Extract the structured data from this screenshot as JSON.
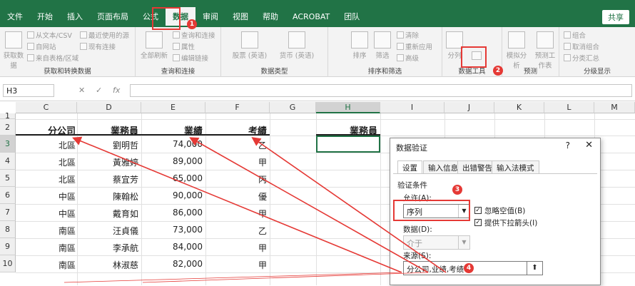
{
  "ribbon_tabs": [
    "文件",
    "开始",
    "插入",
    "页面布局",
    "公式",
    "数据",
    "审阅",
    "视图",
    "帮助",
    "ACROBAT",
    "团队"
  ],
  "active_tab": "数据",
  "share_label": "共享",
  "ribbon": {
    "get_data": "获取数据",
    "get_data_group_items": [
      "从文本/CSV",
      "自网站",
      "来自表格/区域",
      "最近使用的源",
      "现有连接"
    ],
    "get_group_label": "获取和转换数据",
    "refresh_all": "全部刷新",
    "query_items": [
      "查询和连接",
      "属性",
      "编辑链接"
    ],
    "query_group_label": "查询和连接",
    "stock": "股票 (英语)",
    "currency": "货币 (英语)",
    "datatype_group_label": "数据类型",
    "sort": "排序",
    "filter": "筛选",
    "sort_items": [
      "清除",
      "重新应用",
      "高级"
    ],
    "sort_group_label": "排序和筛选",
    "split": "分列",
    "tools_group_label": "数据工具",
    "whatif": "模拟分析",
    "forecast": "预测工作表",
    "forecast_group_label": "预测",
    "outline_items": [
      "组合",
      "取消组合",
      "分类汇总"
    ],
    "outline_group_label": "分级显示"
  },
  "formula_bar": {
    "name_box": "H3",
    "fx": "fx",
    "cancel": "✕",
    "enter": "✓"
  },
  "columns": [
    "C",
    "D",
    "E",
    "F",
    "G",
    "H",
    "I",
    "J",
    "K",
    "L",
    "M"
  ],
  "rows": [
    "1",
    "2",
    "3",
    "4",
    "5",
    "6",
    "7",
    "8",
    "9",
    "10"
  ],
  "headers": {
    "branch": "分公司",
    "salesperson": "業務員",
    "performance": "業績",
    "evaluation": "考績",
    "h_header": "業務員"
  },
  "data_rows": [
    {
      "branch": "北區",
      "name": "劉明哲",
      "amount": "74,000",
      "grade": "乙"
    },
    {
      "branch": "北區",
      "name": "黃雅婷",
      "amount": "89,000",
      "grade": "甲"
    },
    {
      "branch": "北區",
      "name": "蔡宜芳",
      "amount": "65,000",
      "grade": "丙"
    },
    {
      "branch": "中區",
      "name": "陳翰松",
      "amount": "90,000",
      "grade": "優"
    },
    {
      "branch": "中區",
      "name": "戴育如",
      "amount": "86,000",
      "grade": "甲"
    },
    {
      "branch": "南區",
      "name": "汪貞儀",
      "amount": "73,000",
      "grade": "乙"
    },
    {
      "branch": "南區",
      "name": "李承航",
      "amount": "84,000",
      "grade": "甲"
    },
    {
      "branch": "南區",
      "name": "林淑慈",
      "amount": "82,000",
      "grade": "甲"
    }
  ],
  "dialog": {
    "title": "数据验证",
    "help": "?",
    "close": "✕",
    "tabs": [
      "设置",
      "输入信息",
      "出错警告",
      "输入法模式"
    ],
    "criteria_label": "验证条件",
    "allow_label": "允许(A):",
    "allow_value": "序列",
    "ignore_blank": "忽略空值(B)",
    "dropdown": "提供下拉箭头(I)",
    "data_label": "数据(D):",
    "data_value": "介于",
    "source_label": "来源(S):",
    "source_value": "分公司,业绩,考绩"
  },
  "badges": [
    "1",
    "2",
    "3",
    "4"
  ],
  "colors": {
    "excel_green": "#217346",
    "annotation_red": "#e53935"
  }
}
